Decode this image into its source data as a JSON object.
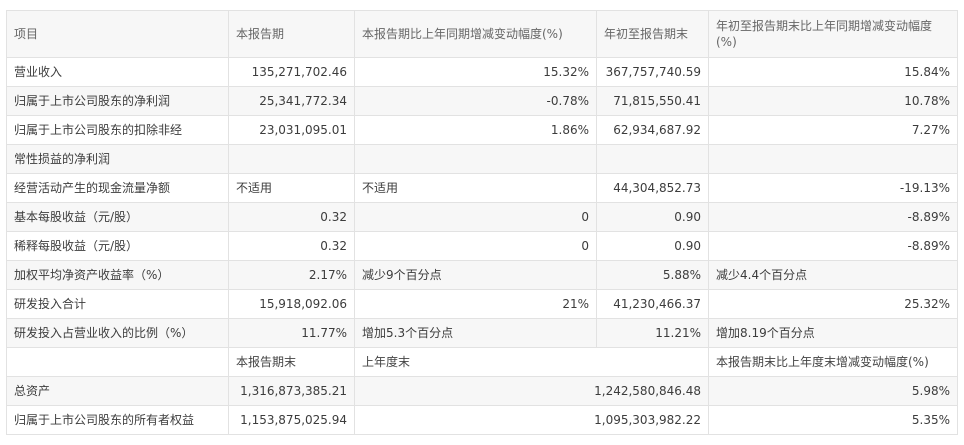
{
  "table": {
    "headers": [
      "项目",
      "本报告期",
      "本报告期比上年同期增减变动幅度(%)",
      "年初至报告期末",
      "年初至报告期末比上年同期增减变动幅度(%)"
    ],
    "rows": [
      {
        "item": "营业收入",
        "current": "135,271,702.46",
        "current_change": "15.32%",
        "ytd": "367,757,740.59",
        "ytd_change": "15.84%"
      },
      {
        "item": "归属于上市公司股东的净利润",
        "current": "25,341,772.34",
        "current_change": "-0.78%",
        "ytd": "71,815,550.41",
        "ytd_change": "10.78%"
      },
      {
        "item": "归属于上市公司股东的扣除非经",
        "current": "23,031,095.01",
        "current_change": "1.86%",
        "ytd": "62,934,687.92",
        "ytd_change": "7.27%"
      },
      {
        "item": "常性损益的净利润",
        "current": "",
        "current_change": "",
        "ytd": "",
        "ytd_change": ""
      },
      {
        "item": "经营活动产生的现金流量净额",
        "current": "不适用",
        "current_change": "不适用",
        "ytd": "44,304,852.73",
        "ytd_change": "-19.13%"
      },
      {
        "item": "基本每股收益（元/股）",
        "current": "0.32",
        "current_change": "0",
        "ytd": "0.90",
        "ytd_change": "-8.89%"
      },
      {
        "item": "稀释每股收益（元/股）",
        "current": "0.32",
        "current_change": "0",
        "ytd": "0.90",
        "ytd_change": "-8.89%"
      },
      {
        "item": "加权平均净资产收益率（%）",
        "current": "2.17%",
        "current_change": "减少9个百分点",
        "ytd": "5.88%",
        "ytd_change": "减少4.4个百分点"
      },
      {
        "item": "研发投入合计",
        "current": "15,918,092.06",
        "current_change": "21%",
        "ytd": "41,230,466.37",
        "ytd_change": "25.32%"
      },
      {
        "item": "研发投入占营业收入的比例（%）",
        "current": "11.77%",
        "current_change": "增加5.3个百分点",
        "ytd": "11.21%",
        "ytd_change": "增加8.19个百分点"
      }
    ],
    "subheaders": [
      "",
      "本报告期末",
      "上年度末",
      "本报告期末比上年度末增减变动幅度(%)"
    ],
    "balance_rows": [
      {
        "item": "总资产",
        "current_end": "1,316,873,385.21",
        "prior_year_end": "1,242,580,846.48",
        "change": "5.98%"
      },
      {
        "item": "归属于上市公司股东的所有者权益",
        "current_end": "1,153,875,025.94",
        "prior_year_end": "1,095,303,982.22",
        "change": "5.35%"
      }
    ]
  }
}
